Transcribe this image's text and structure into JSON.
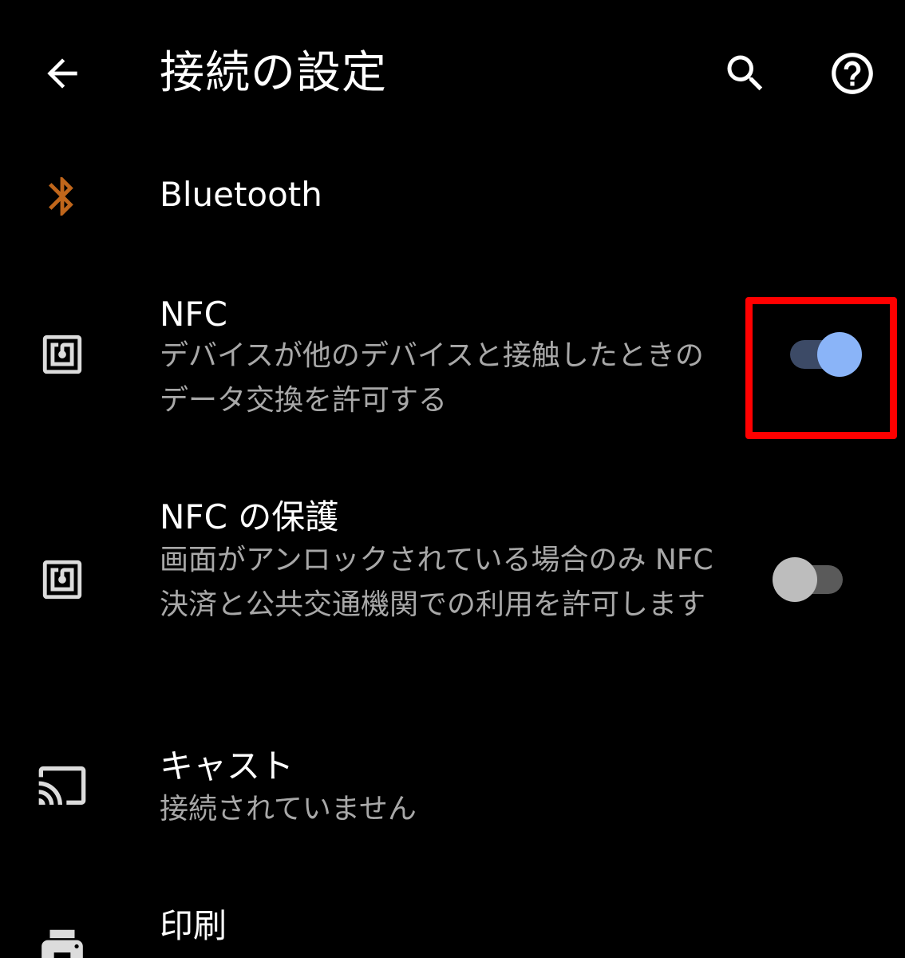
{
  "appbar": {
    "title": "接続の設定",
    "back_icon": "arrow-back-icon",
    "search_icon": "search-icon",
    "help_icon": "help-circle-icon"
  },
  "items": {
    "bluetooth": {
      "title": "Bluetooth",
      "icon": "bluetooth-icon",
      "icon_color": "#c0661b"
    },
    "nfc": {
      "title": "NFC",
      "summary": "デバイスが他のデバイスと接触したときのデータ交換を許可する",
      "icon": "nfc-icon",
      "toggle_on": true
    },
    "nfc_protection": {
      "title": "NFC の保護",
      "summary": "画面がアンロックされている場合のみ NFC 決済と公共交通機関での利用を許可します",
      "icon": "nfc-icon",
      "toggle_on": false
    },
    "cast": {
      "title": "キャスト",
      "summary": "接続されていません",
      "icon": "cast-icon"
    },
    "print": {
      "title": "印刷",
      "icon": "printer-icon"
    }
  },
  "colors": {
    "background": "#000000",
    "title_text": "#ffffff",
    "summary_text": "#a8a8a8",
    "icon": "#dcdcdc",
    "toggle_on_thumb": "#8ab4f8",
    "toggle_on_track": "#3c4a66",
    "toggle_off_thumb": "#bdbdbd",
    "toggle_off_track": "#5a5a5a",
    "highlight": "#ff0000"
  }
}
